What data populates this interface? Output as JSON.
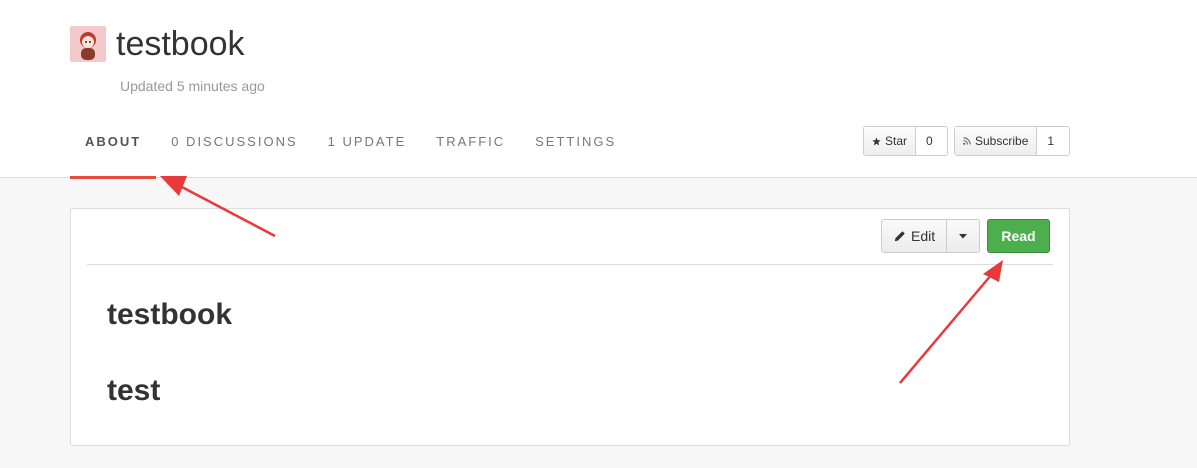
{
  "book": {
    "title": "testbook",
    "updated": "Updated 5 minutes ago"
  },
  "tabs": [
    {
      "label": "ABOUT",
      "active": true
    },
    {
      "label": "0 DISCUSSIONS",
      "active": false
    },
    {
      "label": "1 UPDATE",
      "active": false
    },
    {
      "label": "TRAFFIC",
      "active": false
    },
    {
      "label": "SETTINGS",
      "active": false
    }
  ],
  "actions": {
    "star_label": "Star",
    "star_count": "0",
    "subscribe_label": "Subscribe",
    "subscribe_count": "1"
  },
  "panel": {
    "edit_label": "Edit",
    "read_label": "Read",
    "heading": "testbook",
    "subheading": "test"
  },
  "colors": {
    "active_tab_underline": "#e74c3c",
    "read_button": "#4cae4c",
    "annotation_arrow": "#e8393b"
  }
}
